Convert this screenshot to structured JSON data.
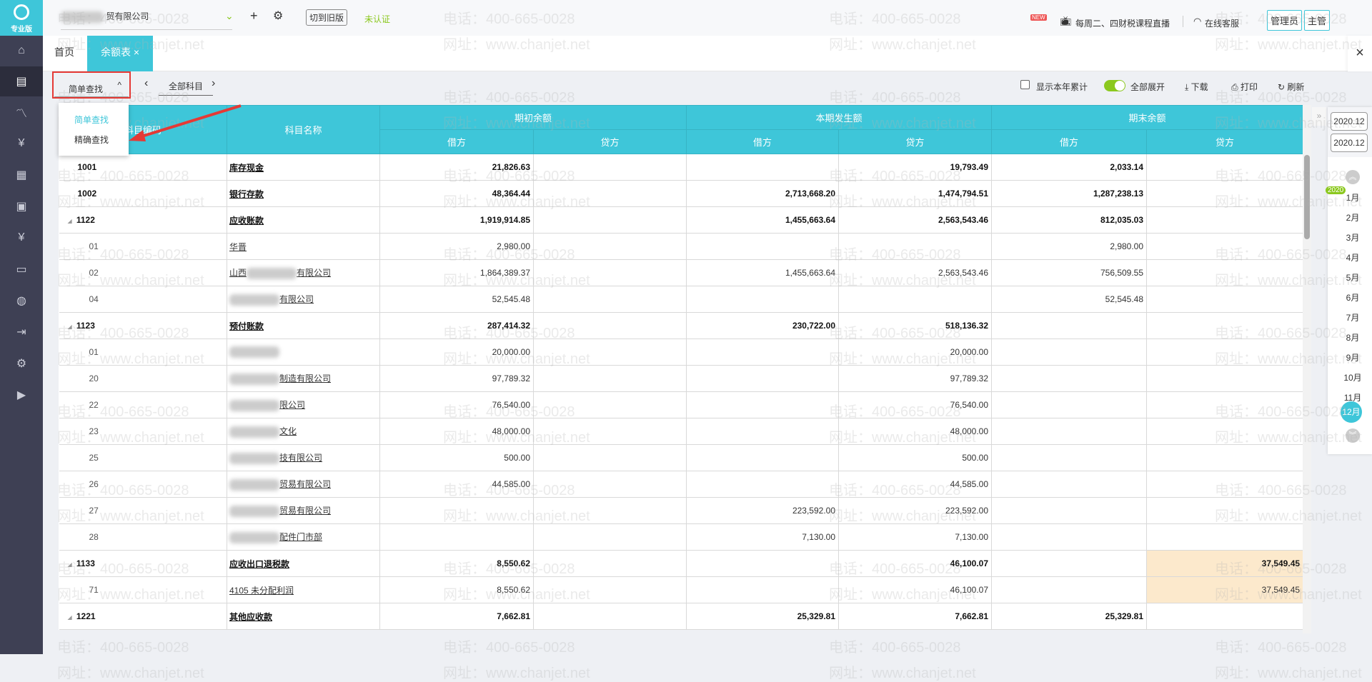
{
  "app": {
    "logo_text": "专业版",
    "company": "贸有限公司",
    "switch_old": "切到旧版",
    "cert_status": "未认证",
    "new_badge": "NEW",
    "live_course": "每周二、四财税课程直播",
    "online_service": "在线客服",
    "role_admin": "管理员",
    "role_supervisor": "主管"
  },
  "tabs": [
    {
      "label": "首页"
    },
    {
      "label": "余额表",
      "close": "×"
    }
  ],
  "toolbar": {
    "search_mode": "简单查找",
    "prev": "‹",
    "subject_filter": "全部科目",
    "next": "›",
    "show_year_total": "显示本年累计",
    "expand_all": "全部展开",
    "download": "下载",
    "print": "打印",
    "refresh": "刷新",
    "close_page": "×"
  },
  "dropdown": {
    "options": [
      "简单查找",
      "精确查找"
    ]
  },
  "table": {
    "headers": {
      "code": "科目编码",
      "name": "科目名称",
      "opening": "期初余额",
      "period": "本期发生额",
      "closing": "期末余额",
      "debit": "借方",
      "credit": "贷方"
    },
    "rows": [
      {
        "level": 1,
        "expand": false,
        "code": "1001",
        "name": "库存现金",
        "v": [
          "21,826.63",
          "",
          "",
          "19,793.49",
          "2,033.14",
          ""
        ]
      },
      {
        "level": 1,
        "expand": false,
        "code": "1002",
        "name": "银行存款",
        "v": [
          "48,364.44",
          "",
          "2,713,668.20",
          "1,474,794.51",
          "1,287,238.13",
          ""
        ]
      },
      {
        "level": 1,
        "expand": true,
        "code": "1122",
        "name": "应收账款",
        "v": [
          "1,919,914.85",
          "",
          "1,455,663.64",
          "2,563,543.46",
          "812,035.03",
          ""
        ]
      },
      {
        "level": 2,
        "code": "01",
        "name": "华晋",
        "v": [
          "2,980.00",
          "",
          "",
          "",
          "2,980.00",
          ""
        ]
      },
      {
        "level": 2,
        "code": "02",
        "prefix": "山西",
        "name": "有限公司",
        "blur": true,
        "v": [
          "1,864,389.37",
          "",
          "1,455,663.64",
          "2,563,543.46",
          "756,509.55",
          ""
        ]
      },
      {
        "level": 2,
        "code": "04",
        "name": "有限公司",
        "blur": true,
        "v": [
          "52,545.48",
          "",
          "",
          "",
          "52,545.48",
          ""
        ]
      },
      {
        "level": 1,
        "expand": true,
        "code": "1123",
        "name": "预付账款",
        "v": [
          "287,414.32",
          "",
          "230,722.00",
          "518,136.32",
          "",
          ""
        ]
      },
      {
        "level": 2,
        "code": "01",
        "name": "",
        "blur": true,
        "v": [
          "20,000.00",
          "",
          "",
          "20,000.00",
          "",
          ""
        ]
      },
      {
        "level": 2,
        "code": "20",
        "name": "制造有限公司",
        "blur": true,
        "v": [
          "97,789.32",
          "",
          "",
          "97,789.32",
          "",
          ""
        ]
      },
      {
        "level": 2,
        "code": "22",
        "name": "限公司",
        "blur": true,
        "v": [
          "76,540.00",
          "",
          "",
          "76,540.00",
          "",
          ""
        ]
      },
      {
        "level": 2,
        "code": "23",
        "name": "文化",
        "blur": true,
        "v": [
          "48,000.00",
          "",
          "",
          "48,000.00",
          "",
          ""
        ]
      },
      {
        "level": 2,
        "code": "25",
        "name": "技有限公司",
        "blur": true,
        "v": [
          "500.00",
          "",
          "",
          "500.00",
          "",
          ""
        ]
      },
      {
        "level": 2,
        "code": "26",
        "name": "贸易有限公司",
        "blur": true,
        "v": [
          "44,585.00",
          "",
          "",
          "44,585.00",
          "",
          ""
        ]
      },
      {
        "level": 2,
        "code": "27",
        "name": "贸易有限公司",
        "blur": true,
        "v": [
          "",
          "",
          "223,592.00",
          "223,592.00",
          "",
          ""
        ]
      },
      {
        "level": 2,
        "code": "28",
        "name": "配件门市部",
        "blur": true,
        "v": [
          "",
          "",
          "7,130.00",
          "7,130.00",
          "",
          ""
        ]
      },
      {
        "level": 1,
        "expand": true,
        "code": "1133",
        "name": "应收出口退税款",
        "hl": true,
        "v": [
          "8,550.62",
          "",
          "",
          "46,100.07",
          "",
          "37,549.45"
        ]
      },
      {
        "level": 2,
        "code": "71",
        "name": "4105 未分配利润",
        "hl": true,
        "v": [
          "8,550.62",
          "",
          "",
          "46,100.07",
          "",
          "37,549.45"
        ]
      },
      {
        "level": 1,
        "expand": true,
        "code": "1221",
        "name": "其他应收款",
        "v": [
          "7,662.81",
          "",
          "25,329.81",
          "7,662.81",
          "25,329.81",
          ""
        ]
      }
    ]
  },
  "period_panel": {
    "start": "2020.12",
    "end": "2020.12",
    "year_badge": "2020",
    "months": [
      "1月",
      "2月",
      "3月",
      "4月",
      "5月",
      "6月",
      "7月",
      "8月",
      "9月",
      "10月",
      "11月",
      "12月"
    ],
    "selected": "12月"
  },
  "watermark": {
    "phone": "电话：400-665-0028",
    "site": "网址：www.chanjet.net"
  },
  "colors": {
    "accent": "#3ec6d9",
    "sidebar": "#3e4054",
    "toggle_on": "#8bc81e",
    "highlight": "#fce9cc",
    "annotation": "#e53935"
  }
}
